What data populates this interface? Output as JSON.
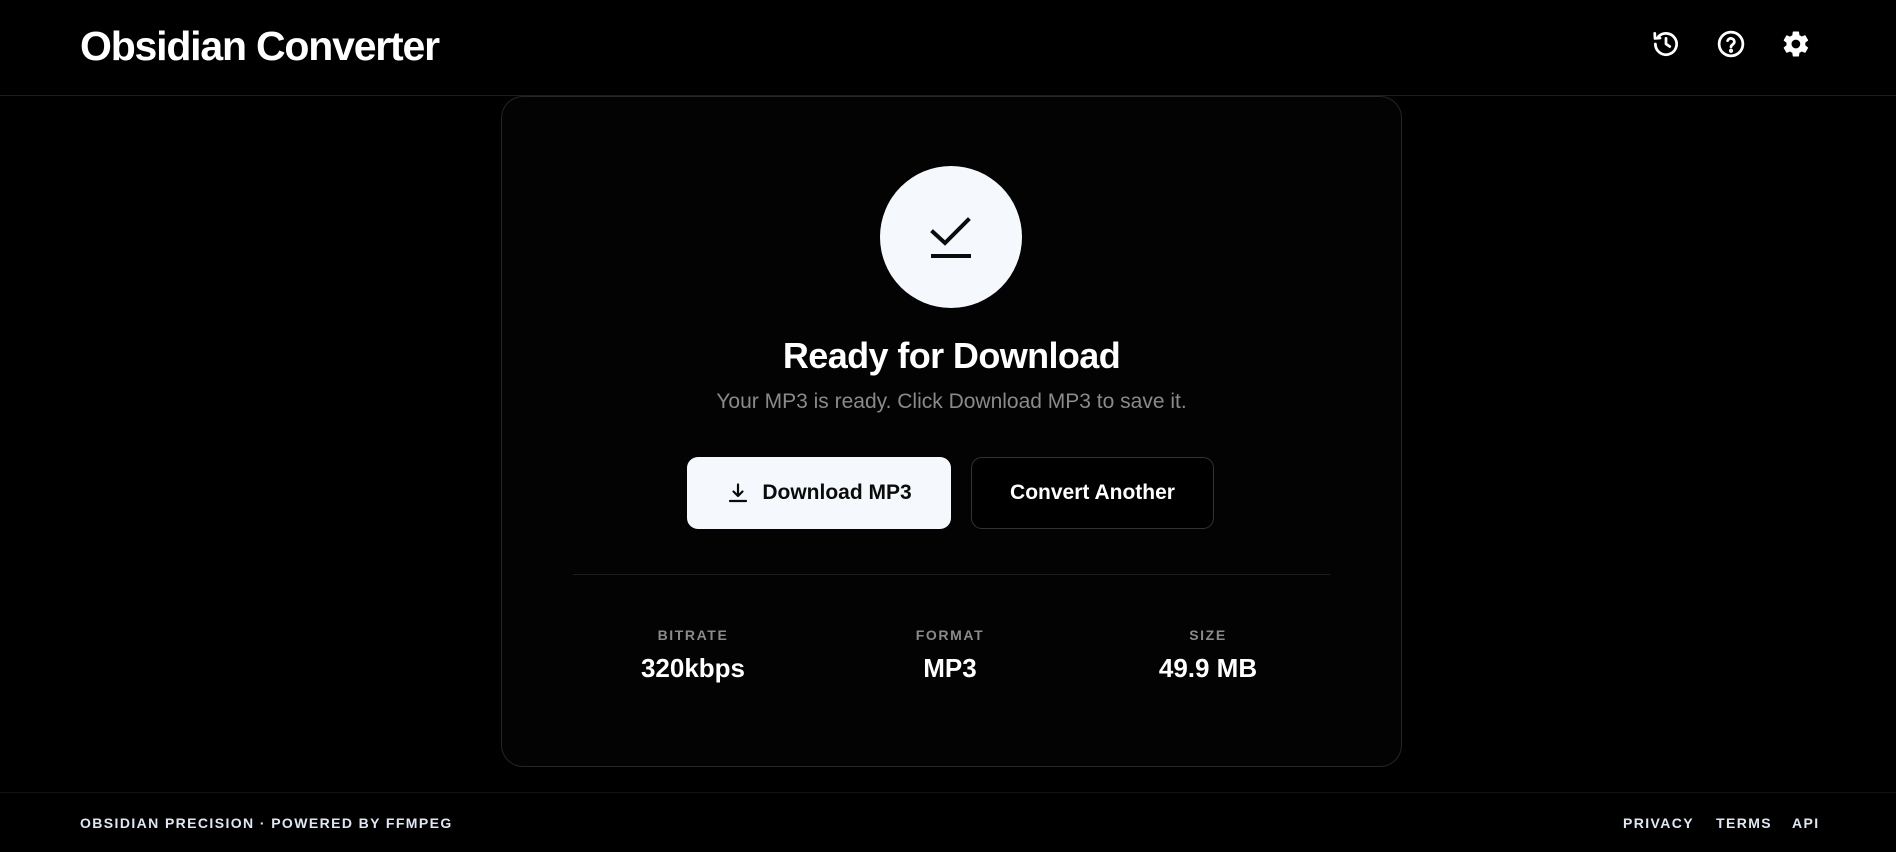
{
  "header": {
    "title": "Obsidian Converter",
    "icons": [
      "history-icon",
      "help-icon",
      "settings-icon"
    ]
  },
  "status": {
    "icon": "download-done-icon",
    "title": "Ready for Download",
    "subtitle": "Your MP3 is ready. Click Download MP3 to save it."
  },
  "actions": {
    "download_label": "Download MP3",
    "download_icon": "download-icon",
    "convert_label": "Convert Another"
  },
  "stats": [
    {
      "label": "BITRATE",
      "value": "320kbps"
    },
    {
      "label": "FORMAT",
      "value": "MP3"
    },
    {
      "label": "SIZE",
      "value": "49.9 MB"
    }
  ],
  "footer": {
    "tagline": "OBSIDIAN PRECISION · POWERED BY FFMPEG",
    "links": [
      "PRIVACY",
      "TERMS",
      "API"
    ]
  },
  "colors": {
    "background": "#000000",
    "accent": "#f5f9fd",
    "muted_text": "#8a8a8a",
    "border": "#262626"
  }
}
